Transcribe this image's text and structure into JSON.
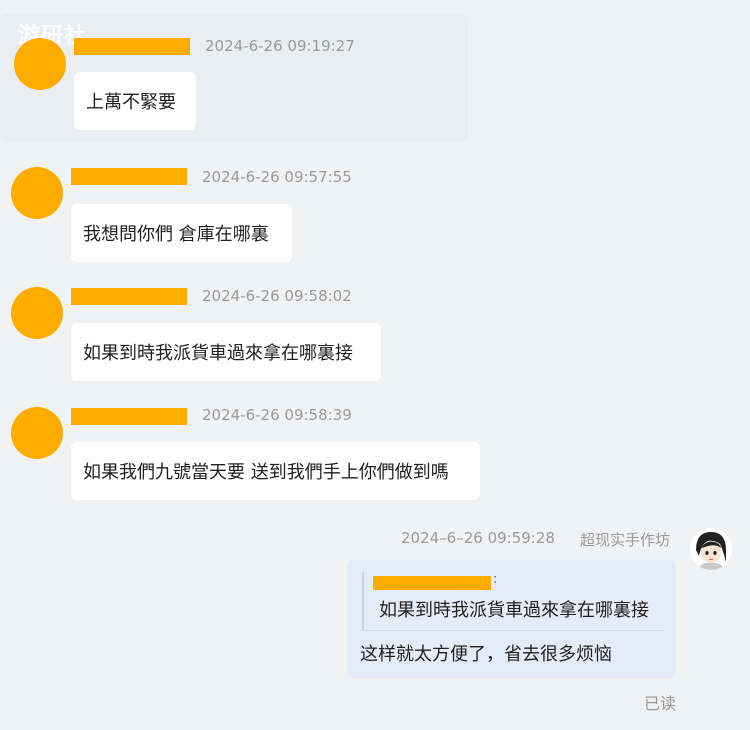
{
  "watermark": "游研社",
  "messages": [
    {
      "timestamp": "2024-6-26 09:19:27",
      "text": "上萬不緊要"
    },
    {
      "timestamp": "2024-6-26 09:57:55",
      "text": "我想問你們 倉庫在哪裏"
    },
    {
      "timestamp": "2024-6-26 09:58:02",
      "text": "如果到時我派貨車過來拿在哪裏接"
    },
    {
      "timestamp": "2024-6-26 09:58:39",
      "text": "如果我們九號當天要 送到我們手上你們做到嗎"
    }
  ],
  "self_message": {
    "timestamp": "2024–6–26 09:59:28",
    "sender": "超现实手作坊",
    "quote_text": "如果到時我派貨車過來拿在哪裏接",
    "reply_text": "这样就太方便了，省去很多烦恼",
    "status": "已读"
  },
  "colors": {
    "redaction": "#ffac00",
    "background": "#f1f2f4",
    "self_bubble": "#e4ecf8"
  }
}
